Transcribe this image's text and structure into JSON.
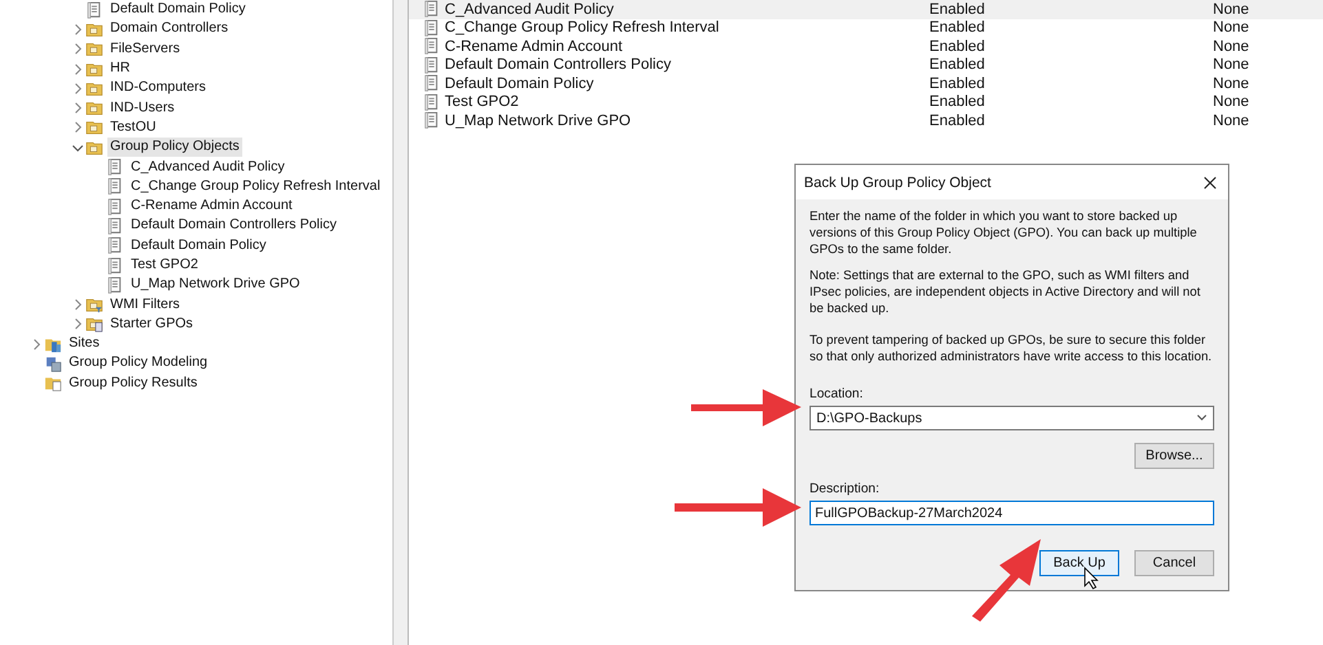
{
  "tree": [
    {
      "children": [
        {
          "label": "Default Domain Policy",
          "kind": "gpo-link",
          "selected": false
        },
        {
          "label": "Domain Controllers",
          "kind": "ou",
          "expanded": false,
          "selected": false
        },
        {
          "label": "FileServers",
          "kind": "ou",
          "expanded": false,
          "selected": false
        },
        {
          "label": "HR",
          "kind": "ou",
          "expanded": false,
          "selected": false
        },
        {
          "label": "IND-Computers",
          "kind": "ou",
          "expanded": false,
          "selected": false
        },
        {
          "label": "IND-Users",
          "kind": "ou",
          "expanded": false,
          "selected": false
        },
        {
          "label": "TestOU",
          "kind": "ou",
          "expanded": false,
          "selected": false
        },
        {
          "label": "Group Policy Objects",
          "kind": "gpo-folder",
          "expanded": true,
          "selected": true,
          "children": [
            {
              "label": "C_Advanced Audit Policy",
              "kind": "gpo",
              "selected": false
            },
            {
              "label": "C_Change Group Policy Refresh Interval",
              "kind": "gpo",
              "selected": false
            },
            {
              "label": "C-Rename Admin Account",
              "kind": "gpo",
              "selected": false
            },
            {
              "label": "Default Domain Controllers Policy",
              "kind": "gpo",
              "selected": false
            },
            {
              "label": "Default Domain Policy",
              "kind": "gpo",
              "selected": false
            },
            {
              "label": "Test GPO2",
              "kind": "gpo",
              "selected": false
            },
            {
              "label": "U_Map Network Drive GPO",
              "kind": "gpo",
              "selected": false
            }
          ]
        },
        {
          "label": "WMI Filters",
          "kind": "wmi",
          "expanded": false,
          "selected": false
        },
        {
          "label": "Starter GPOs",
          "kind": "starter",
          "expanded": false,
          "selected": false
        }
      ]
    },
    {
      "label": "Sites",
      "kind": "sites",
      "expanded": false,
      "selected": false
    },
    {
      "label": "Group Policy Modeling",
      "kind": "modeling",
      "selected": false
    },
    {
      "label": "Group Policy Results",
      "kind": "results",
      "selected": false
    }
  ],
  "list": {
    "rows": [
      {
        "name": "C_Advanced Audit Policy",
        "status": "Enabled",
        "column_3": "None",
        "selected": true
      },
      {
        "name": "C_Change Group Policy Refresh Interval",
        "status": "Enabled",
        "column_3": "None",
        "selected": false
      },
      {
        "name": "C-Rename Admin Account",
        "status": "Enabled",
        "column_3": "None",
        "selected": false
      },
      {
        "name": "Default Domain Controllers Policy",
        "status": "Enabled",
        "column_3": "None",
        "selected": false
      },
      {
        "name": "Default Domain Policy",
        "status": "Enabled",
        "column_3": "None",
        "selected": false
      },
      {
        "name": "Test GPO2",
        "status": "Enabled",
        "column_3": "None",
        "selected": false
      },
      {
        "name": "U_Map Network Drive GPO",
        "status": "Enabled",
        "column_3": "None",
        "selected": false
      }
    ]
  },
  "dialog": {
    "title": "Back Up Group Policy Object",
    "paragraphs": [
      "Enter the name of the folder in which you want to store backed up versions of this Group Policy Object (GPO). You can back up multiple GPOs to the same folder.",
      "Note: Settings that are external to the GPO, such as WMI filters and IPsec policies, are independent objects in Active Directory and will not be backed up.",
      "To prevent tampering of backed up GPOs, be sure to secure this folder so that only authorized administrators have write access to this location."
    ],
    "location_label": "Location:",
    "location_value": "D:\\GPO-Backups",
    "browse_button": "Browse...",
    "description_label": "Description:",
    "description_value": "FullGPOBackup-27March2024",
    "buttons": [
      {
        "label": "Back Up",
        "default": true
      },
      {
        "label": "Cancel",
        "default": false
      }
    ]
  }
}
